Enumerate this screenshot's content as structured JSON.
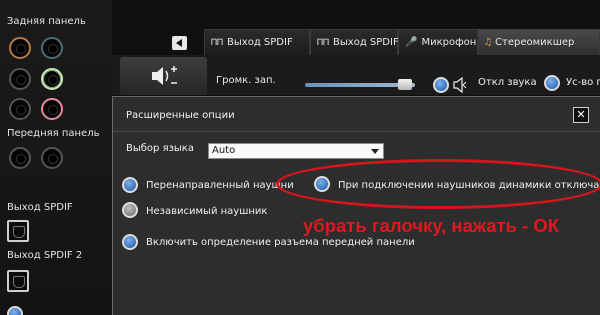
{
  "left_panel": {
    "back_label": "Задняя панель",
    "front_label": "Передняя панель",
    "spdif1_label": "Выход SPDIF",
    "spdif2_label": "Выход SPDIF 2"
  },
  "tabs": [
    {
      "glyph": "⊓⊓",
      "label": "Выход SPDIF"
    },
    {
      "glyph": "⊓⊓",
      "label": "Выход SPDIF 2"
    },
    {
      "glyph": "🎤",
      "label": "Микрофон"
    },
    {
      "glyph": "♫",
      "label": "Стереомикшер"
    }
  ],
  "strip": {
    "record_volume_label": "Громк. зап.",
    "mute_label": "Откл звука",
    "amp_label": "Ус-во п"
  },
  "dialog": {
    "title": "Расширенные опции",
    "close_glyph": "✕",
    "language_label": "Выбор языка",
    "language_value": "Auto",
    "options": {
      "redirected": "Перенаправленный наушни",
      "speakers_off": "При подключении наушников динамики отключаются",
      "independent": "Независимый наушник",
      "jack_detect": "Включить определение разъема передней панели"
    }
  },
  "annotation": "убрать галочку, нажать - ОК",
  "colors": {
    "annotation_red": "#e0171c",
    "radio_blue": "#3f79c4",
    "dialog_bg": "#2d2d2d"
  }
}
